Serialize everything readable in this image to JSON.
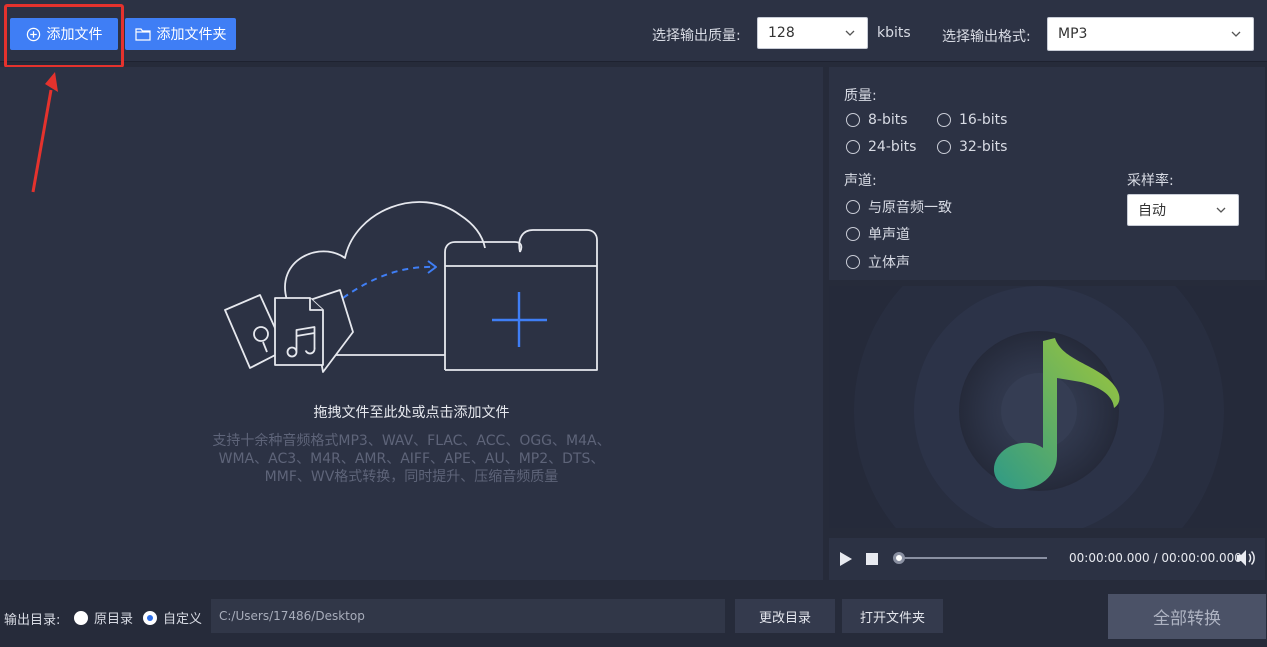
{
  "toolbar": {
    "add_file_label": "添加文件",
    "add_folder_label": "添加文件夹",
    "quality_label": "选择输出质量:",
    "quality_value": "128",
    "quality_unit": "kbits",
    "format_label": "选择输出格式:",
    "format_value": "MP3"
  },
  "drop_area": {
    "title": "拖拽文件至此处或点击添加文件",
    "hint_line1": "支持十余种音频格式MP3、WAV、FLAC、ACC、OGG、M4A、",
    "hint_line2": "WMA、AC3、M4R、AMR、AIFF、APE、AU、MP2、DTS、",
    "hint_line3": "MMF、WV格式转换，同时提升、压缩音频质量"
  },
  "settings": {
    "quality_title": "质量:",
    "quality_options": [
      "8-bits",
      "16-bits",
      "24-bits",
      "32-bits"
    ],
    "channel_title": "声道:",
    "channel_options": [
      "与原音频一致",
      "单声道",
      "立体声"
    ],
    "sample_rate_title": "采样率:",
    "sample_rate_value": "自动"
  },
  "player": {
    "time_current": "00:00:00.000",
    "time_separator": "/",
    "time_total": "00:00:00.000",
    "progress": 0
  },
  "bottom": {
    "output_dir_label": "输出目录:",
    "option_original": "原目录",
    "option_custom": "自定义",
    "path_value": "C:/Users/17486/Desktop",
    "change_dir_label": "更改目录",
    "open_folder_label": "打开文件夹",
    "convert_all_label": "全部转换"
  },
  "colors": {
    "accent": "#3f7ef5",
    "highlight": "#e5322d",
    "background": "#262b3a",
    "panel": "#2c3244"
  }
}
